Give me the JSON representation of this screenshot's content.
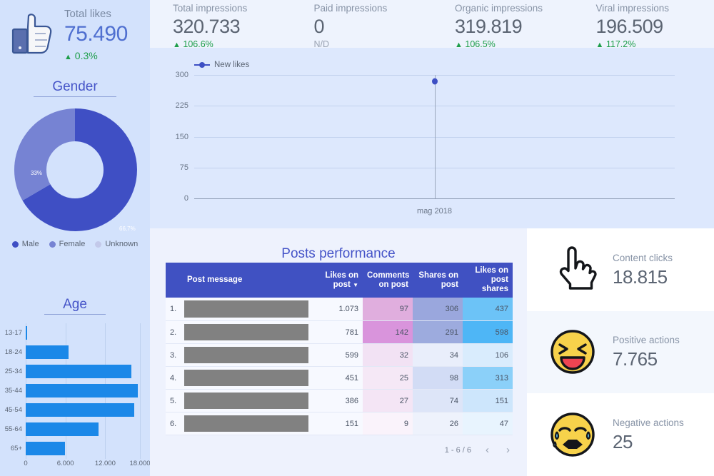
{
  "total_likes": {
    "icon": "facebook-thumbs-up-icon",
    "title": "Total likes",
    "value": "75.490",
    "delta": "0.3%",
    "delta_arrow": "▲"
  },
  "kpis": [
    {
      "title": "Total impressions",
      "value": "320.733",
      "delta": "106.6%",
      "delta_arrow": "▲",
      "na": false
    },
    {
      "title": "Paid impressions",
      "value": "0",
      "delta": "N/D",
      "delta_arrow": "",
      "na": true
    },
    {
      "title": "Organic impressions",
      "value": "319.819",
      "delta": "106.5%",
      "delta_arrow": "▲",
      "na": false
    },
    {
      "title": "Viral impressions",
      "value": "196.509",
      "delta": "117.2%",
      "delta_arrow": "▲",
      "na": false
    }
  ],
  "gender": {
    "title": "Gender",
    "legend": [
      {
        "label": "Male",
        "color": "#3f4fc4"
      },
      {
        "label": "Female",
        "color": "#7683d3"
      },
      {
        "label": "Unknown",
        "color": "#c3c9ea"
      }
    ],
    "slice_labels": {
      "male": "66,7%",
      "female": "33%"
    }
  },
  "age": {
    "title": "Age",
    "x_ticks": [
      "0",
      "6.000",
      "12.000",
      "18.000"
    ]
  },
  "line_chart_legend": "New likes",
  "posts": {
    "title": "Posts performance",
    "columns": {
      "index": "",
      "message": "Post message",
      "likes": "Likes on post",
      "comments": "Comments on post",
      "shares": "Shares on post",
      "share_likes": "Likes on post shares"
    },
    "sort_caret": "▼",
    "rows": [
      {
        "idx": "1.",
        "message": "",
        "likes": "1.073",
        "comments": "97",
        "shares": "306",
        "share_likes": "437"
      },
      {
        "idx": "2.",
        "message": "",
        "likes": "781",
        "comments": "142",
        "shares": "291",
        "share_likes": "598"
      },
      {
        "idx": "3.",
        "message": "",
        "likes": "599",
        "comments": "32",
        "shares": "34",
        "share_likes": "106"
      },
      {
        "idx": "4.",
        "message": "",
        "likes": "451",
        "comments": "25",
        "shares": "98",
        "share_likes": "313"
      },
      {
        "idx": "5.",
        "message": "",
        "likes": "386",
        "comments": "27",
        "shares": "74",
        "share_likes": "151"
      },
      {
        "idx": "6.",
        "message": "",
        "likes": "151",
        "comments": "9",
        "shares": "26",
        "share_likes": "47"
      }
    ],
    "pagination": {
      "range": "1 - 6 / 6",
      "prev": "‹",
      "next": "›"
    }
  },
  "right_cards": [
    {
      "icon": "pointing-hand-cursor-icon",
      "title": "Content clicks",
      "value": "18.815"
    },
    {
      "icon": "laughing-emoji-icon",
      "title": "Positive actions",
      "value": "7.765"
    },
    {
      "icon": "crying-emoji-icon",
      "title": "Negative actions",
      "value": "25"
    }
  ],
  "colors": {
    "accent_blue": "#4051c2",
    "bar_blue": "#1b88e8",
    "positive_green": "#1e9e4a"
  },
  "chart_data": [
    {
      "type": "pie",
      "title": "Gender",
      "labels": [
        "Male",
        "Female",
        "Unknown"
      ],
      "values": [
        66.7,
        33.0,
        0.3
      ],
      "display_labels": [
        "66,7%",
        "33%",
        ""
      ],
      "colors": [
        "#3f4fc4",
        "#7683d3",
        "#c3c9ea"
      ],
      "donut": true,
      "legend_position": "bottom"
    },
    {
      "type": "bar",
      "title": "Age",
      "orientation": "horizontal",
      "categories": [
        "13-17",
        "18-24",
        "25-34",
        "35-44",
        "45-54",
        "55-64",
        "65+"
      ],
      "values": [
        220,
        6700,
        16700,
        17700,
        17050,
        11500,
        6200
      ],
      "xlabel": "",
      "ylabel": "",
      "xlim": [
        0,
        18000
      ],
      "xticks": [
        0,
        6000,
        12000,
        18000
      ],
      "xtick_labels": [
        "0",
        "6.000",
        "12.000",
        "18.000"
      ],
      "grid": true,
      "color": "#1b88e8"
    },
    {
      "type": "line",
      "title": "",
      "series": [
        {
          "name": "New likes",
          "values": [
            285
          ]
        }
      ],
      "x": [
        "mag 2018"
      ],
      "xlabel": "",
      "ylabel": "",
      "ylim": [
        0,
        300
      ],
      "yticks": [
        0,
        75,
        150,
        225,
        300
      ],
      "ytick_labels": [
        "0",
        "75",
        "150",
        "225",
        "300"
      ],
      "grid": true,
      "legend_position": "top-left",
      "color": "#3d4fc4"
    },
    {
      "type": "table",
      "title": "Posts performance",
      "columns": [
        "Post message",
        "Likes on post",
        "Comments on post",
        "Shares on post",
        "Likes on post shares"
      ],
      "rows": [
        [
          "",
          1073,
          97,
          306,
          437
        ],
        [
          "",
          781,
          142,
          291,
          598
        ],
        [
          "",
          599,
          32,
          34,
          106
        ],
        [
          "",
          451,
          25,
          98,
          313
        ],
        [
          "",
          386,
          27,
          74,
          151
        ],
        [
          "",
          151,
          9,
          26,
          47
        ]
      ]
    }
  ]
}
